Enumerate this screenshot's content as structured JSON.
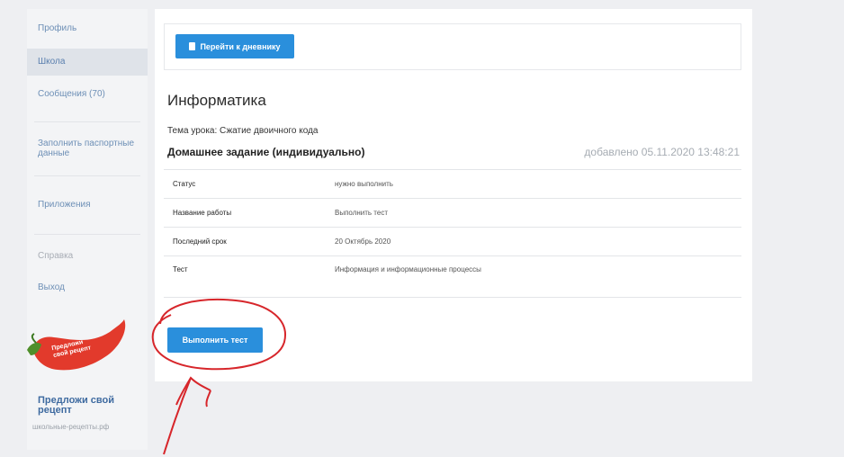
{
  "sidebar": {
    "items": [
      {
        "label": "Профиль"
      },
      {
        "label": "Школа"
      },
      {
        "label": "Сообщения (70)"
      },
      {
        "label": "Заполнить паспортные данные"
      },
      {
        "label": "Приложения"
      },
      {
        "label": "Справка"
      },
      {
        "label": "Выход"
      }
    ],
    "promo": {
      "badge": "Предложи свой рецепт",
      "title": "Предложи свой рецепт",
      "subtitle": "школьные-рецепты.рф"
    }
  },
  "main": {
    "go_button": "Перейти к дневнику",
    "subject": "Информатика",
    "topic": "Тема урока: Сжатие двоичного кода",
    "homework_title": "Домашнее задание (индивидуально)",
    "added": "добавлено 05.11.2020 13:48:21",
    "rows": [
      {
        "key": "Статус",
        "value": "нужно выполнить"
      },
      {
        "key": "Название работы",
        "value": "Выполнить тест"
      },
      {
        "key": "Последний срок",
        "value": "20 Октябрь 2020"
      },
      {
        "key": "Тест",
        "value": "Информация и информационные процессы"
      }
    ],
    "do_button": "Выполнить тест"
  },
  "colors": {
    "accent": "#2a8fdc",
    "annotation": "#d7262b"
  }
}
